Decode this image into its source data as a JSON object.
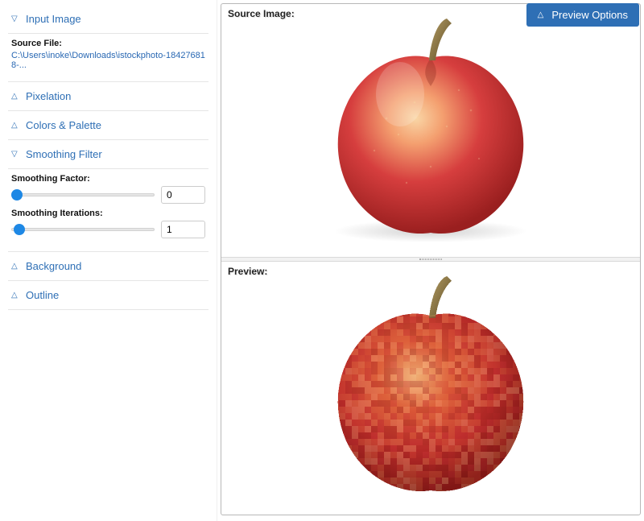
{
  "sidebar": {
    "sections": {
      "input_image": {
        "label": "Input Image",
        "open": true
      },
      "pixelation": {
        "label": "Pixelation",
        "open": false
      },
      "colors_palette": {
        "label": "Colors & Palette",
        "open": false
      },
      "smoothing": {
        "label": "Smoothing Filter",
        "open": true
      },
      "background": {
        "label": "Background",
        "open": false
      },
      "outline": {
        "label": "Outline",
        "open": false
      }
    },
    "input_image": {
      "source_file_label": "Source File:",
      "source_file_path": "C:\\Users\\inoke\\Downloads\\istockphoto-184276818-..."
    },
    "smoothing": {
      "factor_label": "Smoothing Factor:",
      "factor_value": "0",
      "iterations_label": "Smoothing Iterations:",
      "iterations_value": "1"
    }
  },
  "preview_options_label": "Preview Options",
  "panes": {
    "source_label": "Source Image:",
    "preview_label": "Preview:"
  },
  "colors": {
    "accent": "#2e6fb5"
  }
}
